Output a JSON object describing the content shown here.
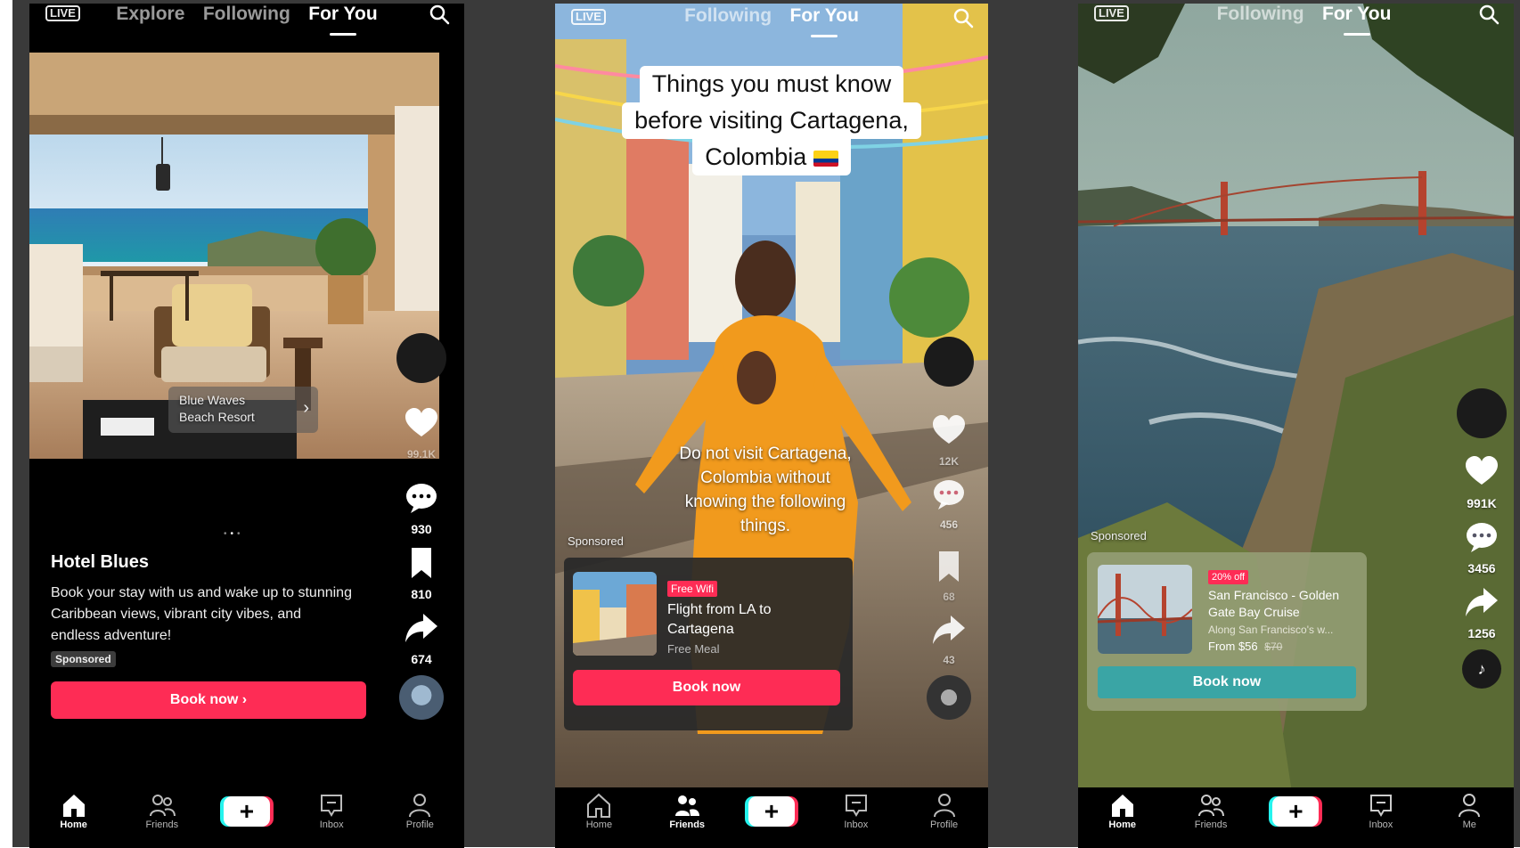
{
  "screens": [
    {
      "live_label": "LIVE",
      "tabs": [
        "Explore",
        "Following",
        "For You"
      ],
      "active_tab": 2,
      "place_card": {
        "line1": "Blue Waves",
        "line2": "Beach Resort"
      },
      "counts": {
        "likes": "99.1K",
        "comments": "930",
        "bookmarks": "810",
        "shares": "674"
      },
      "hotel_name": "Hotel Blues",
      "description": "Book your stay with us and wake up to stunning Caribbean views, vibrant city vibes, and endless adventure!",
      "sponsored": "Sponsored",
      "book_button": "Book now  ›",
      "nav": [
        "Home",
        "Friends",
        "Inbox",
        "Profile"
      ],
      "active_nav": "Home"
    },
    {
      "live_label": "LIVE",
      "tabs": [
        "Following",
        "For You"
      ],
      "active_tab": 1,
      "headline": {
        "line1": "Things you must know",
        "line2": "before visiting Cartagena,",
        "line3": "Colombia"
      },
      "caption": {
        "line1": "Do not visit Cartagena,",
        "line2": "Colombia without",
        "line3": "knowing the following",
        "line4": "things."
      },
      "counts": {
        "likes": "12K",
        "comments": "456",
        "bookmarks": "68",
        "shares": "43"
      },
      "sponsored": "Sponsored",
      "ad_card": {
        "badge": "Free Wifi",
        "title_line1": "Flight from LA to",
        "title_line2": "Cartagena",
        "subtitle": "Free Meal",
        "button": "Book now"
      },
      "nav": [
        "Home",
        "Friends",
        "Inbox",
        "Profile"
      ],
      "active_nav": "Friends"
    },
    {
      "live_label": "LIVE",
      "tabs": [
        "Following",
        "For You"
      ],
      "active_tab": 1,
      "counts": {
        "likes": "991K",
        "comments": "3456",
        "shares": "1256"
      },
      "sponsored": "Sponsored",
      "ad_card": {
        "badge": "20% off",
        "title_line1": "San Francisco - Golden",
        "title_line2": "Gate Bay Cruise",
        "subtitle": "Along San Francisco's w...",
        "price": "From $56",
        "old_price": "$70",
        "button": "Book now"
      },
      "nav": [
        "Home",
        "Friends",
        "Inbox",
        "Me"
      ],
      "active_nav": "Home"
    }
  ],
  "colors": {
    "accent_red": "#fe2c55",
    "accent_teal": "#3aa5a5",
    "tiktok_cyan": "#25f4ee"
  }
}
